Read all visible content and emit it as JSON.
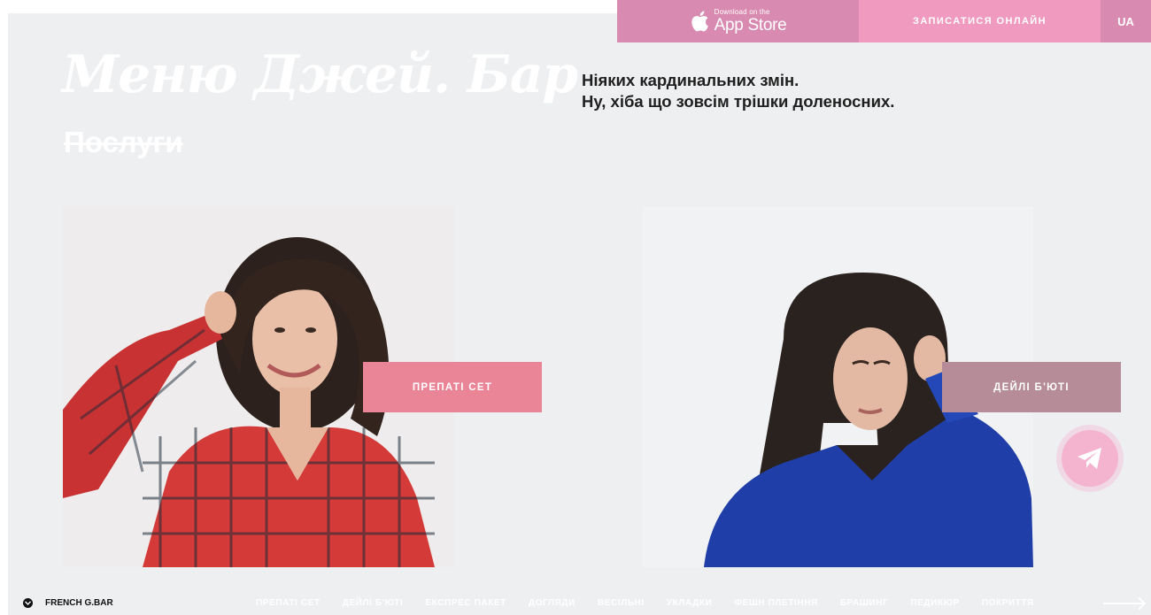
{
  "header": {
    "appstore_small": "Download on the",
    "appstore_big": "App Store",
    "book_online": "ЗАПИСАТИСЯ ОНЛАЙН",
    "language": "UA"
  },
  "title": "Меню Джей. Бар",
  "subtitle": "Послуги",
  "intro": {
    "line1": "Ніяких кардинальних змін.",
    "line2": "Ну, хіба що зовсім трішки доленосних."
  },
  "cards": [
    {
      "label": "ПРЕПАТІ СЕТ"
    },
    {
      "label": "ДЕЙЛІ Б'ЮТІ"
    }
  ],
  "footer": {
    "brand": "FRENCH G.BAR",
    "nav": [
      "ПРЕПАТІ СЕТ",
      "ДЕЙЛІ Б'ЮТІ",
      "ЕКСПРЕС ПАКЕТ",
      "ДОГЛЯДИ",
      "ВЕСІЛЬНІ",
      "УКЛАДКИ",
      "ФЕШН ПЛЕТІННЯ",
      "БРАШИНГ",
      "ПЕДИКЮР",
      "ПОКРИТТЯ"
    ]
  },
  "colors": {
    "accent_pink": "#f09ac0",
    "accent_dark_pink": "#d98ab0",
    "button_left": "#ea8497",
    "button_right": "#b58c97",
    "background": "#eeeff1"
  },
  "icons": {
    "apple": "apple-icon",
    "telegram": "telegram-icon",
    "chevron": "chevron-down-icon",
    "arrow": "arrow-right-icon"
  }
}
